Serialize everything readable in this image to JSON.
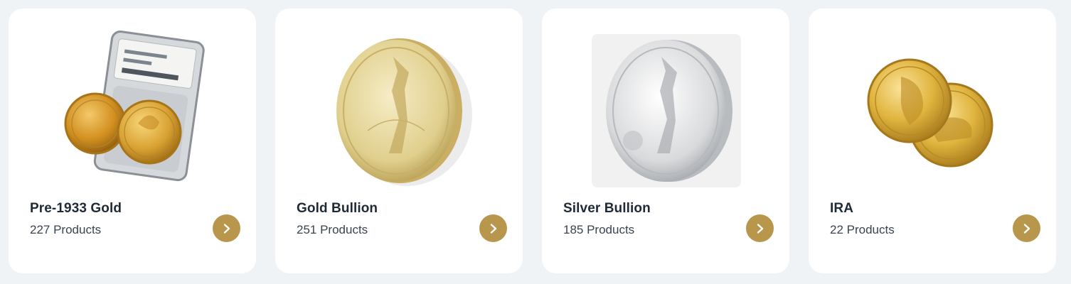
{
  "accent_color": "#b8974d",
  "cards": [
    {
      "title": "Pre-1933 Gold",
      "count": "227 Products",
      "image_icon": "graded-gold-coin-slab",
      "arrow_icon": "chevron-right-icon"
    },
    {
      "title": "Gold Bullion",
      "count": "251 Products",
      "image_icon": "gold-eagle-coin",
      "arrow_icon": "chevron-right-icon"
    },
    {
      "title": "Silver Bullion",
      "count": "185 Products",
      "image_icon": "silver-eagle-coin",
      "arrow_icon": "chevron-right-icon"
    },
    {
      "title": "IRA",
      "count": "22 Products",
      "image_icon": "gold-buffalo-coins",
      "arrow_icon": "chevron-right-icon"
    }
  ]
}
